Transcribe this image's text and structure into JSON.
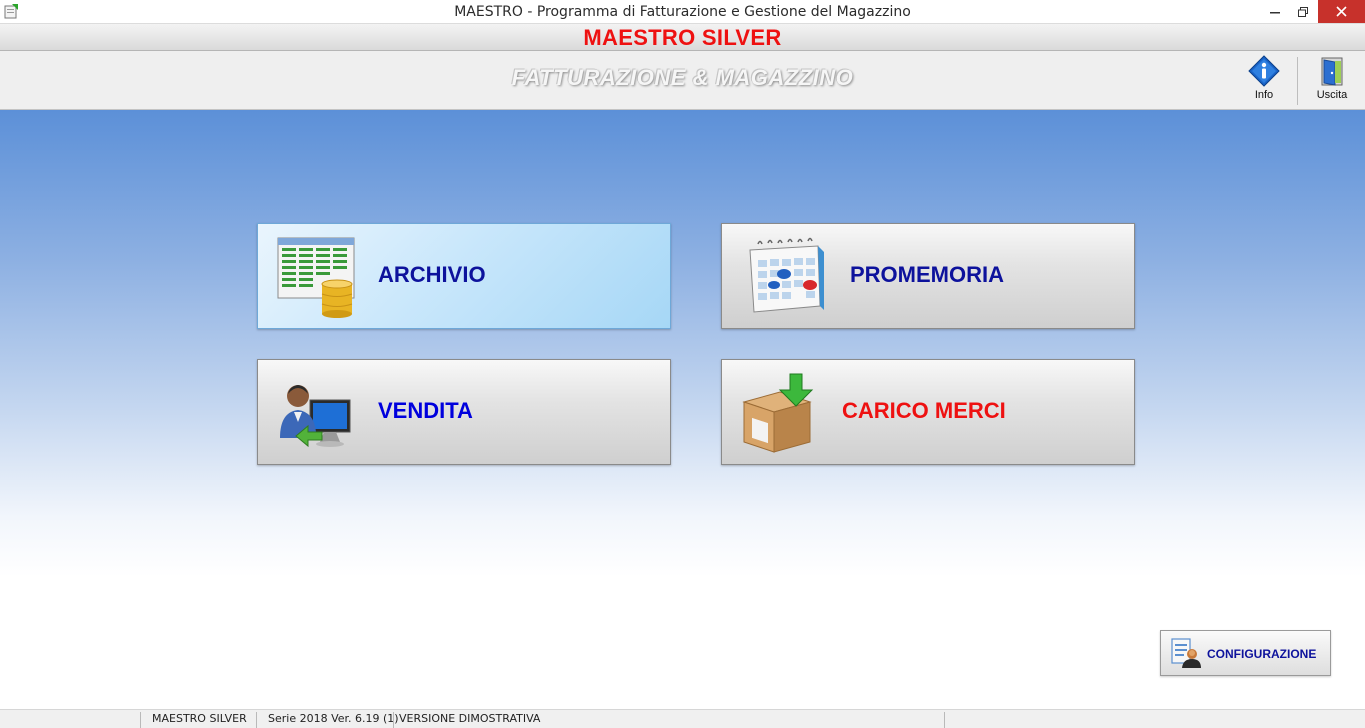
{
  "window": {
    "title": "MAESTRO - Programma di Fatturazione e Gestione del Magazzino",
    "controls": [
      "minimize-icon",
      "restore-icon",
      "close-icon"
    ],
    "close_color": "#c7312b"
  },
  "header": {
    "brand": "MAESTRO SILVER",
    "brand_color": "#ee1111",
    "subtitle": "FATTURAZIONE & MAGAZZINO"
  },
  "toolbar": {
    "info_label": "Info",
    "exit_label": "Uscita"
  },
  "tiles": {
    "archivio": {
      "label": "ARCHIVIO",
      "icon": "spreadsheet-database-icon",
      "color": "#0d129c",
      "active": true
    },
    "promemoria": {
      "label": "PROMEMORIA",
      "icon": "calendar-icon",
      "color": "#0d129c"
    },
    "vendita": {
      "label": "VENDITA",
      "icon": "user-computer-icon",
      "color": "#0000dd"
    },
    "carico": {
      "label": "CARICO MERCI",
      "icon": "box-download-icon",
      "color": "#ee1111"
    }
  },
  "config": {
    "label": "CONFIGURAZIONE",
    "icon": "settings-user-icon"
  },
  "status": {
    "app": "MAESTRO SILVER",
    "version": "Serie 2018 Ver. 6.19 (1)",
    "edition": "VERSIONE DIMOSTRATIVA"
  }
}
